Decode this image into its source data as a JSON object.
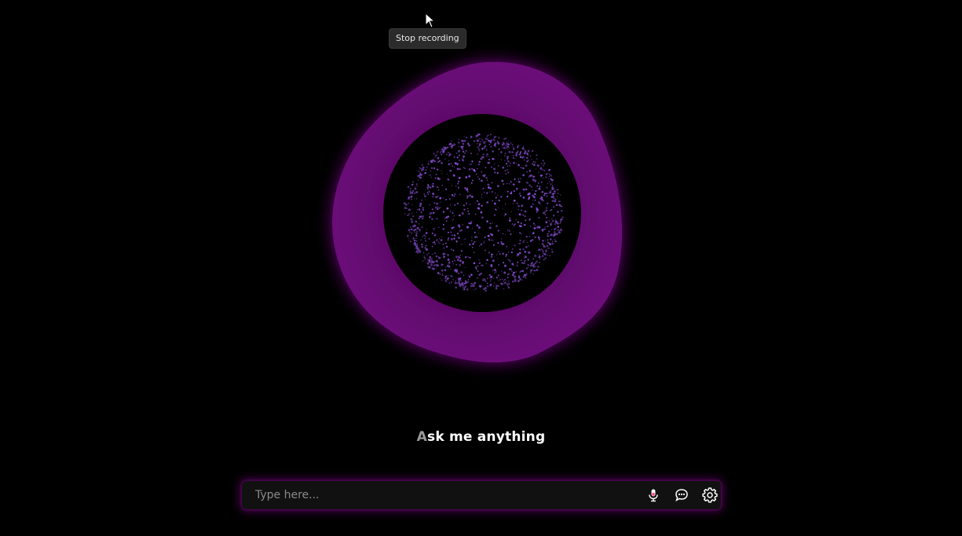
{
  "tooltip": {
    "text": "Stop recording"
  },
  "prompt": {
    "first_letter": "A",
    "rest": "sk me anything"
  },
  "input": {
    "placeholder": "Type here...",
    "value": ""
  },
  "icons": {
    "mic": "microphone-icon",
    "chat": "chat-bubble-icon",
    "settings": "gear-icon"
  },
  "colors": {
    "background": "#000000",
    "orb_purple": "#6a0a78",
    "particle_purple": "#8a4fd8",
    "input_glow": "#7a0084"
  }
}
